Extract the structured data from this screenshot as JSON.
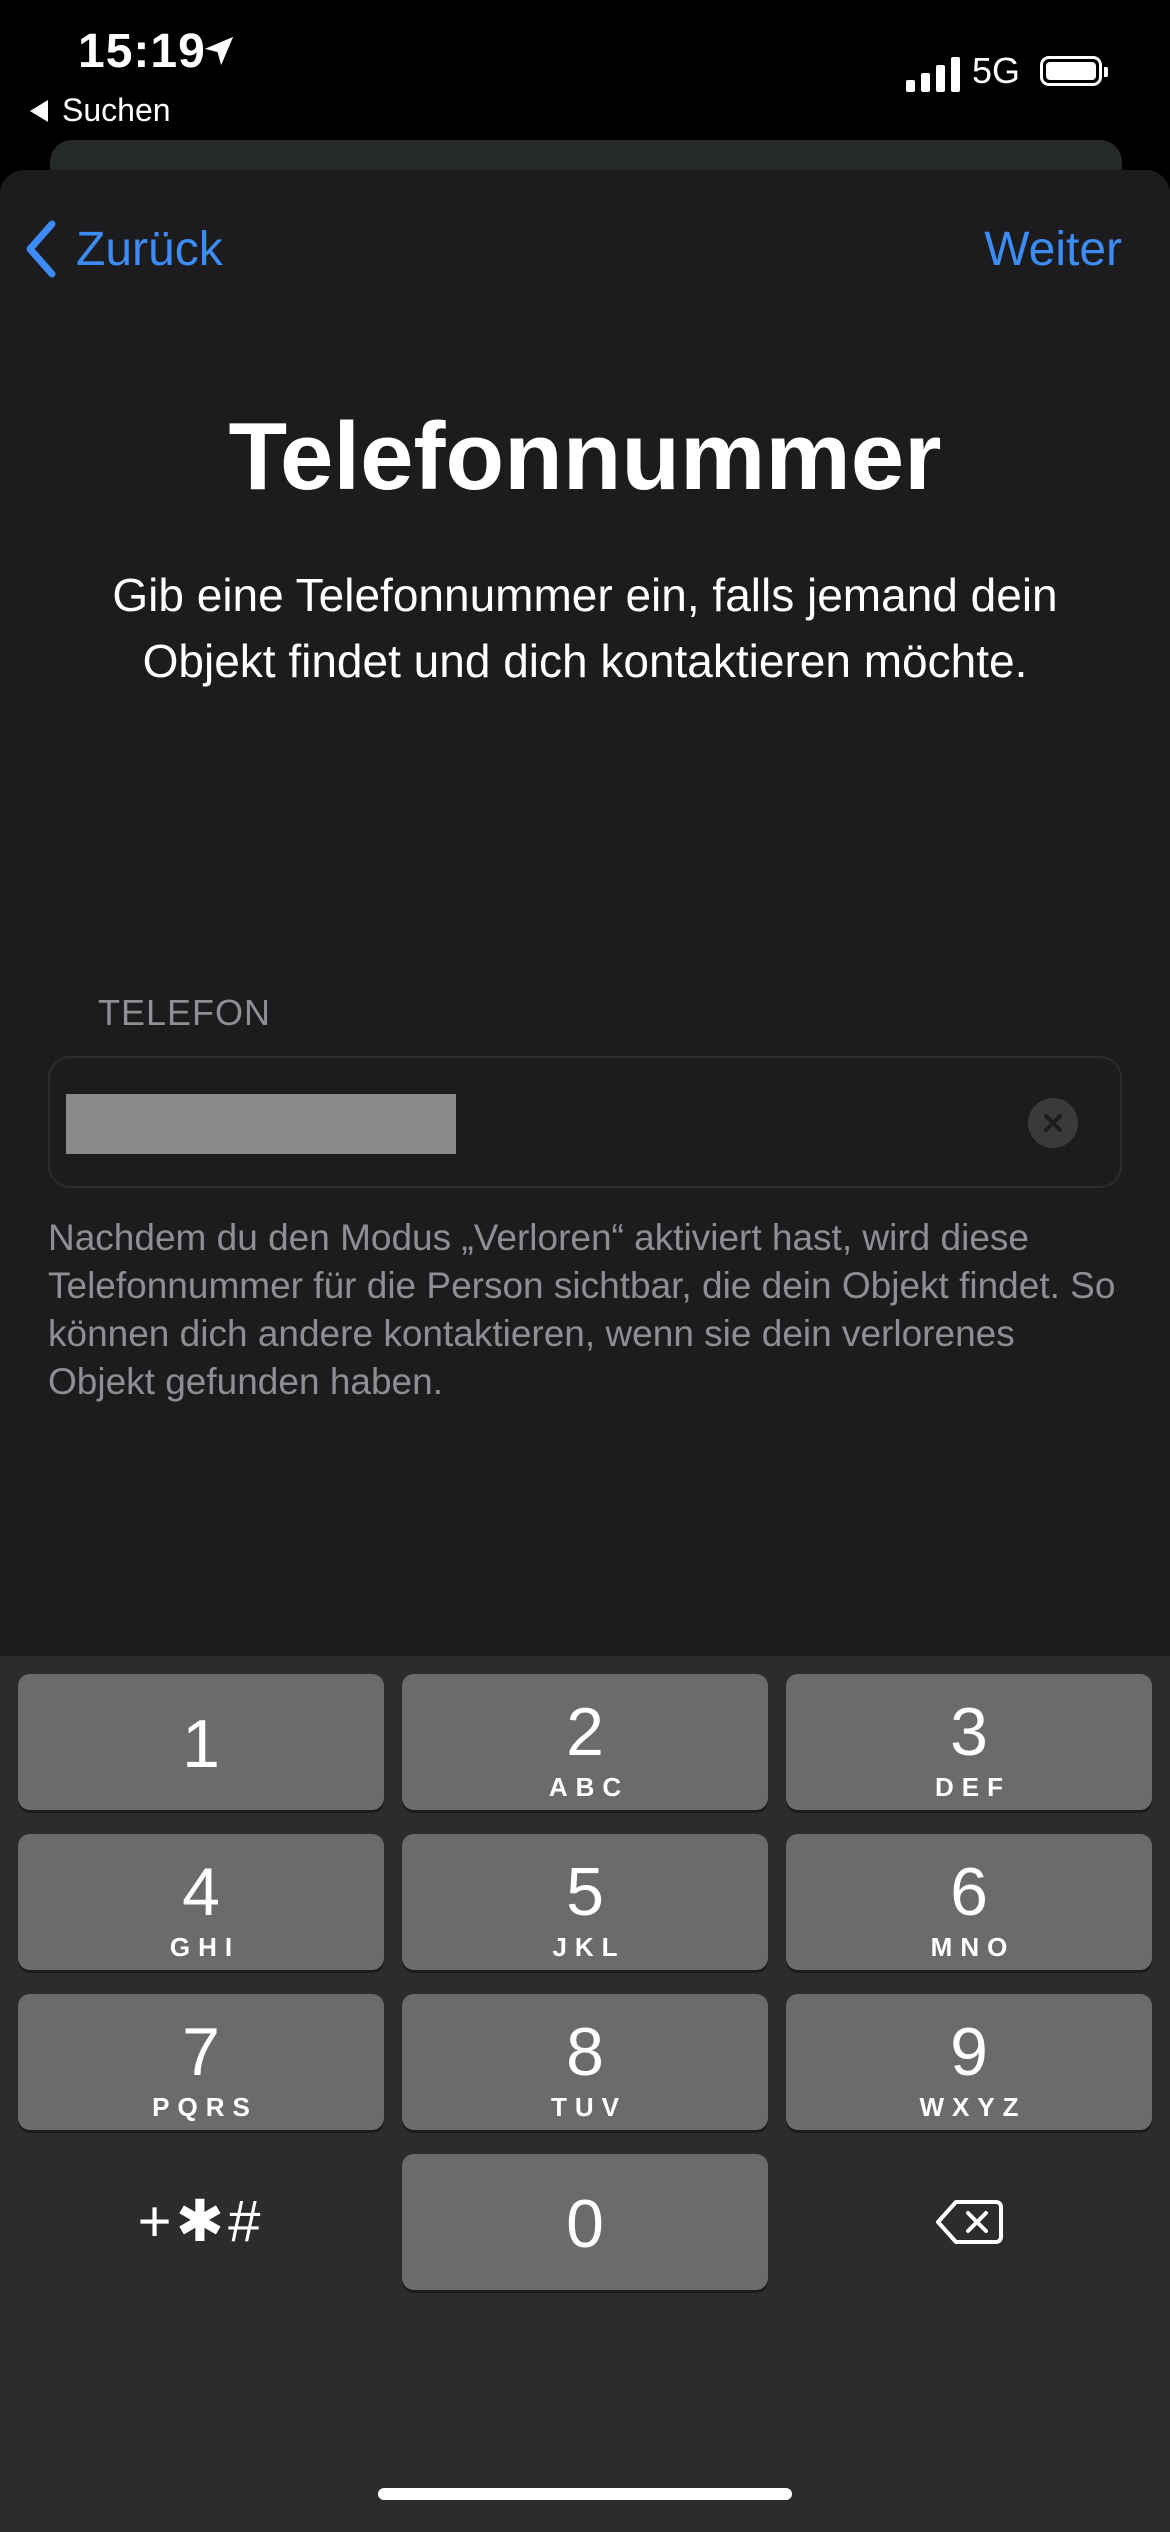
{
  "status_bar": {
    "time": "15:19",
    "back_app": "Suchen",
    "network": "5G",
    "location_icon": "location-arrow-icon"
  },
  "nav": {
    "back_label": "Zurück",
    "next_label": "Weiter"
  },
  "header": {
    "title": "Telefonnummer",
    "subtitle": "Gib eine Telefonnummer ein, falls jemand dein Objekt findet und dich kontaktieren möchte."
  },
  "phone_field": {
    "label": "TELEFON",
    "value": "",
    "clear_icon": "clear-icon"
  },
  "hint": "Nachdem du den Modus „Verloren“ aktiviert hast, wird diese Telefonnummer für die Person sichtbar, die dein Objekt findet. So können dich andere kontaktieren, wenn sie dein verlorenes Objekt gefunden haben.",
  "keypad": {
    "keys": [
      {
        "num": "1",
        "letters": ""
      },
      {
        "num": "2",
        "letters": "ABC"
      },
      {
        "num": "3",
        "letters": "DEF"
      },
      {
        "num": "4",
        "letters": "GHI"
      },
      {
        "num": "5",
        "letters": "JKL"
      },
      {
        "num": "6",
        "letters": "MNO"
      },
      {
        "num": "7",
        "letters": "PQRS"
      },
      {
        "num": "8",
        "letters": "TUV"
      },
      {
        "num": "9",
        "letters": "WXYZ"
      },
      {
        "num": "0",
        "letters": ""
      }
    ],
    "symbols_label": "+✱#",
    "delete_icon": "backspace-icon"
  },
  "colors": {
    "accent": "#3d8cf5",
    "sheet_bg": "#1c1c1e",
    "key_bg": "#6b6b6d",
    "keypad_bg": "#2c2c2e"
  }
}
